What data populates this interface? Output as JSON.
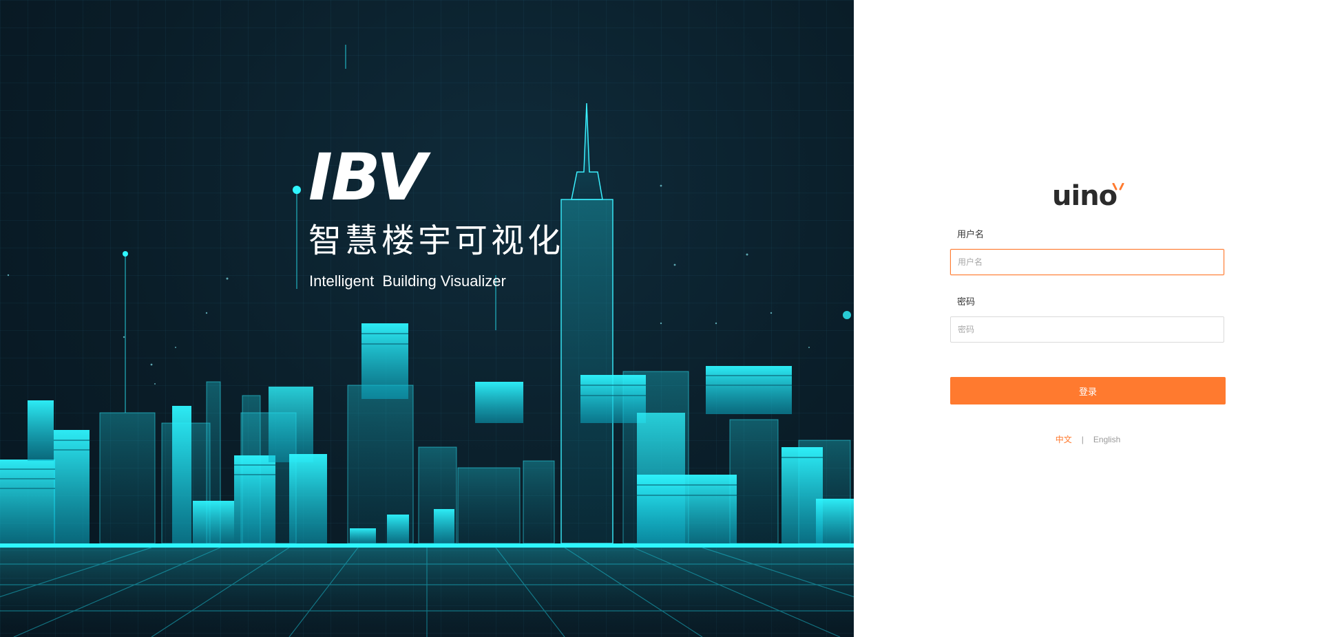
{
  "hero": {
    "title": "IBV",
    "subtitle_cn": "智慧楼宇可视化",
    "subtitle_en": "Intelligent  Building Visualizer"
  },
  "login": {
    "logo_text": "uino",
    "username_label": "用户名",
    "username_placeholder": "用户名",
    "username_value": "",
    "password_label": "密码",
    "password_placeholder": "密码",
    "password_value": "",
    "submit_label": "登录",
    "lang_cn": "中文",
    "lang_separator": "|",
    "lang_en": "English",
    "active_language": "中文"
  },
  "colors": {
    "accent": "#ff7a2f",
    "hero_background": "#0a1d28",
    "hero_glow": "#18e8f2",
    "logo": "#2b2b2b"
  },
  "icons": {
    "logo_mark": "uino-logo-icon"
  }
}
